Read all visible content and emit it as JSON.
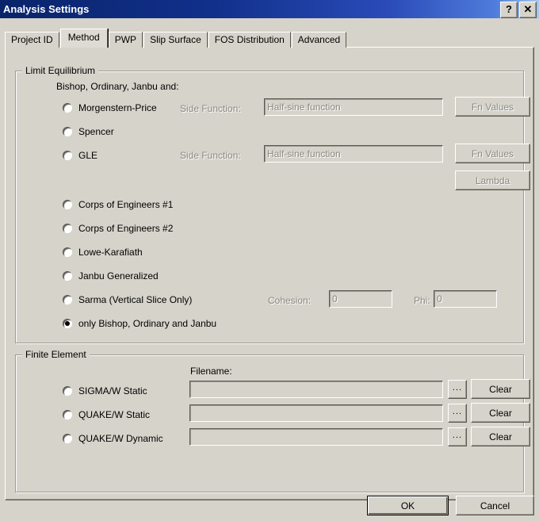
{
  "window": {
    "title": "Analysis Settings",
    "help_button": "?",
    "close_button": "✕",
    "help_icon_name": "help-icon",
    "close_icon_name": "close-icon"
  },
  "tabs": [
    {
      "label": "Project ID",
      "active": false
    },
    {
      "label": "Method",
      "active": true
    },
    {
      "label": "PWP",
      "active": false
    },
    {
      "label": "Slip Surface",
      "active": false
    },
    {
      "label": "FOS Distribution",
      "active": false
    },
    {
      "label": "Advanced",
      "active": false
    }
  ],
  "limit_equilibrium": {
    "group_label": "Limit Equilibrium",
    "intro_label": "Bishop, Ordinary, Janbu and:",
    "side_function_label_1": "Side Function:",
    "side_function_label_2": "Side Function:",
    "side_function_value_1": "Half-sine function",
    "side_function_value_2": "Half-sine function",
    "fn_values_button_1": "Fn Values",
    "fn_values_button_2": "Fn Values",
    "lambda_button": "Lambda",
    "cohesion_label": "Cohesion:",
    "cohesion_value": "0",
    "phi_label": "Phi:",
    "phi_value": "0",
    "methods": [
      {
        "label": "Morgenstern-Price",
        "selected": false
      },
      {
        "label": "Spencer",
        "selected": false
      },
      {
        "label": "GLE",
        "selected": false
      },
      {
        "label": "Corps of Engineers #1",
        "selected": false
      },
      {
        "label": "Corps of Engineers #2",
        "selected": false
      },
      {
        "label": "Lowe-Karafiath",
        "selected": false
      },
      {
        "label": "Janbu Generalized",
        "selected": false
      },
      {
        "label": "Sarma (Vertical Slice Only)",
        "selected": false
      },
      {
        "label": "only Bishop, Ordinary and Janbu",
        "selected": true
      }
    ]
  },
  "finite_element": {
    "group_label": "Finite Element",
    "filename_label": "Filename:",
    "rows": [
      {
        "label": "SIGMA/W Static",
        "selected": false,
        "filename": "",
        "browse": "...",
        "clear": "Clear"
      },
      {
        "label": "QUAKE/W Static",
        "selected": false,
        "filename": "",
        "browse": "...",
        "clear": "Clear"
      },
      {
        "label": "QUAKE/W Dynamic",
        "selected": false,
        "filename": "",
        "browse": "...",
        "clear": "Clear"
      }
    ]
  },
  "footer": {
    "ok_button": "OK",
    "cancel_button": "Cancel"
  },
  "colors": {
    "face": "#d6d3ca",
    "title_start": "#0a246a",
    "title_end": "#a6c8f0",
    "disabled_text": "#8a8880"
  }
}
